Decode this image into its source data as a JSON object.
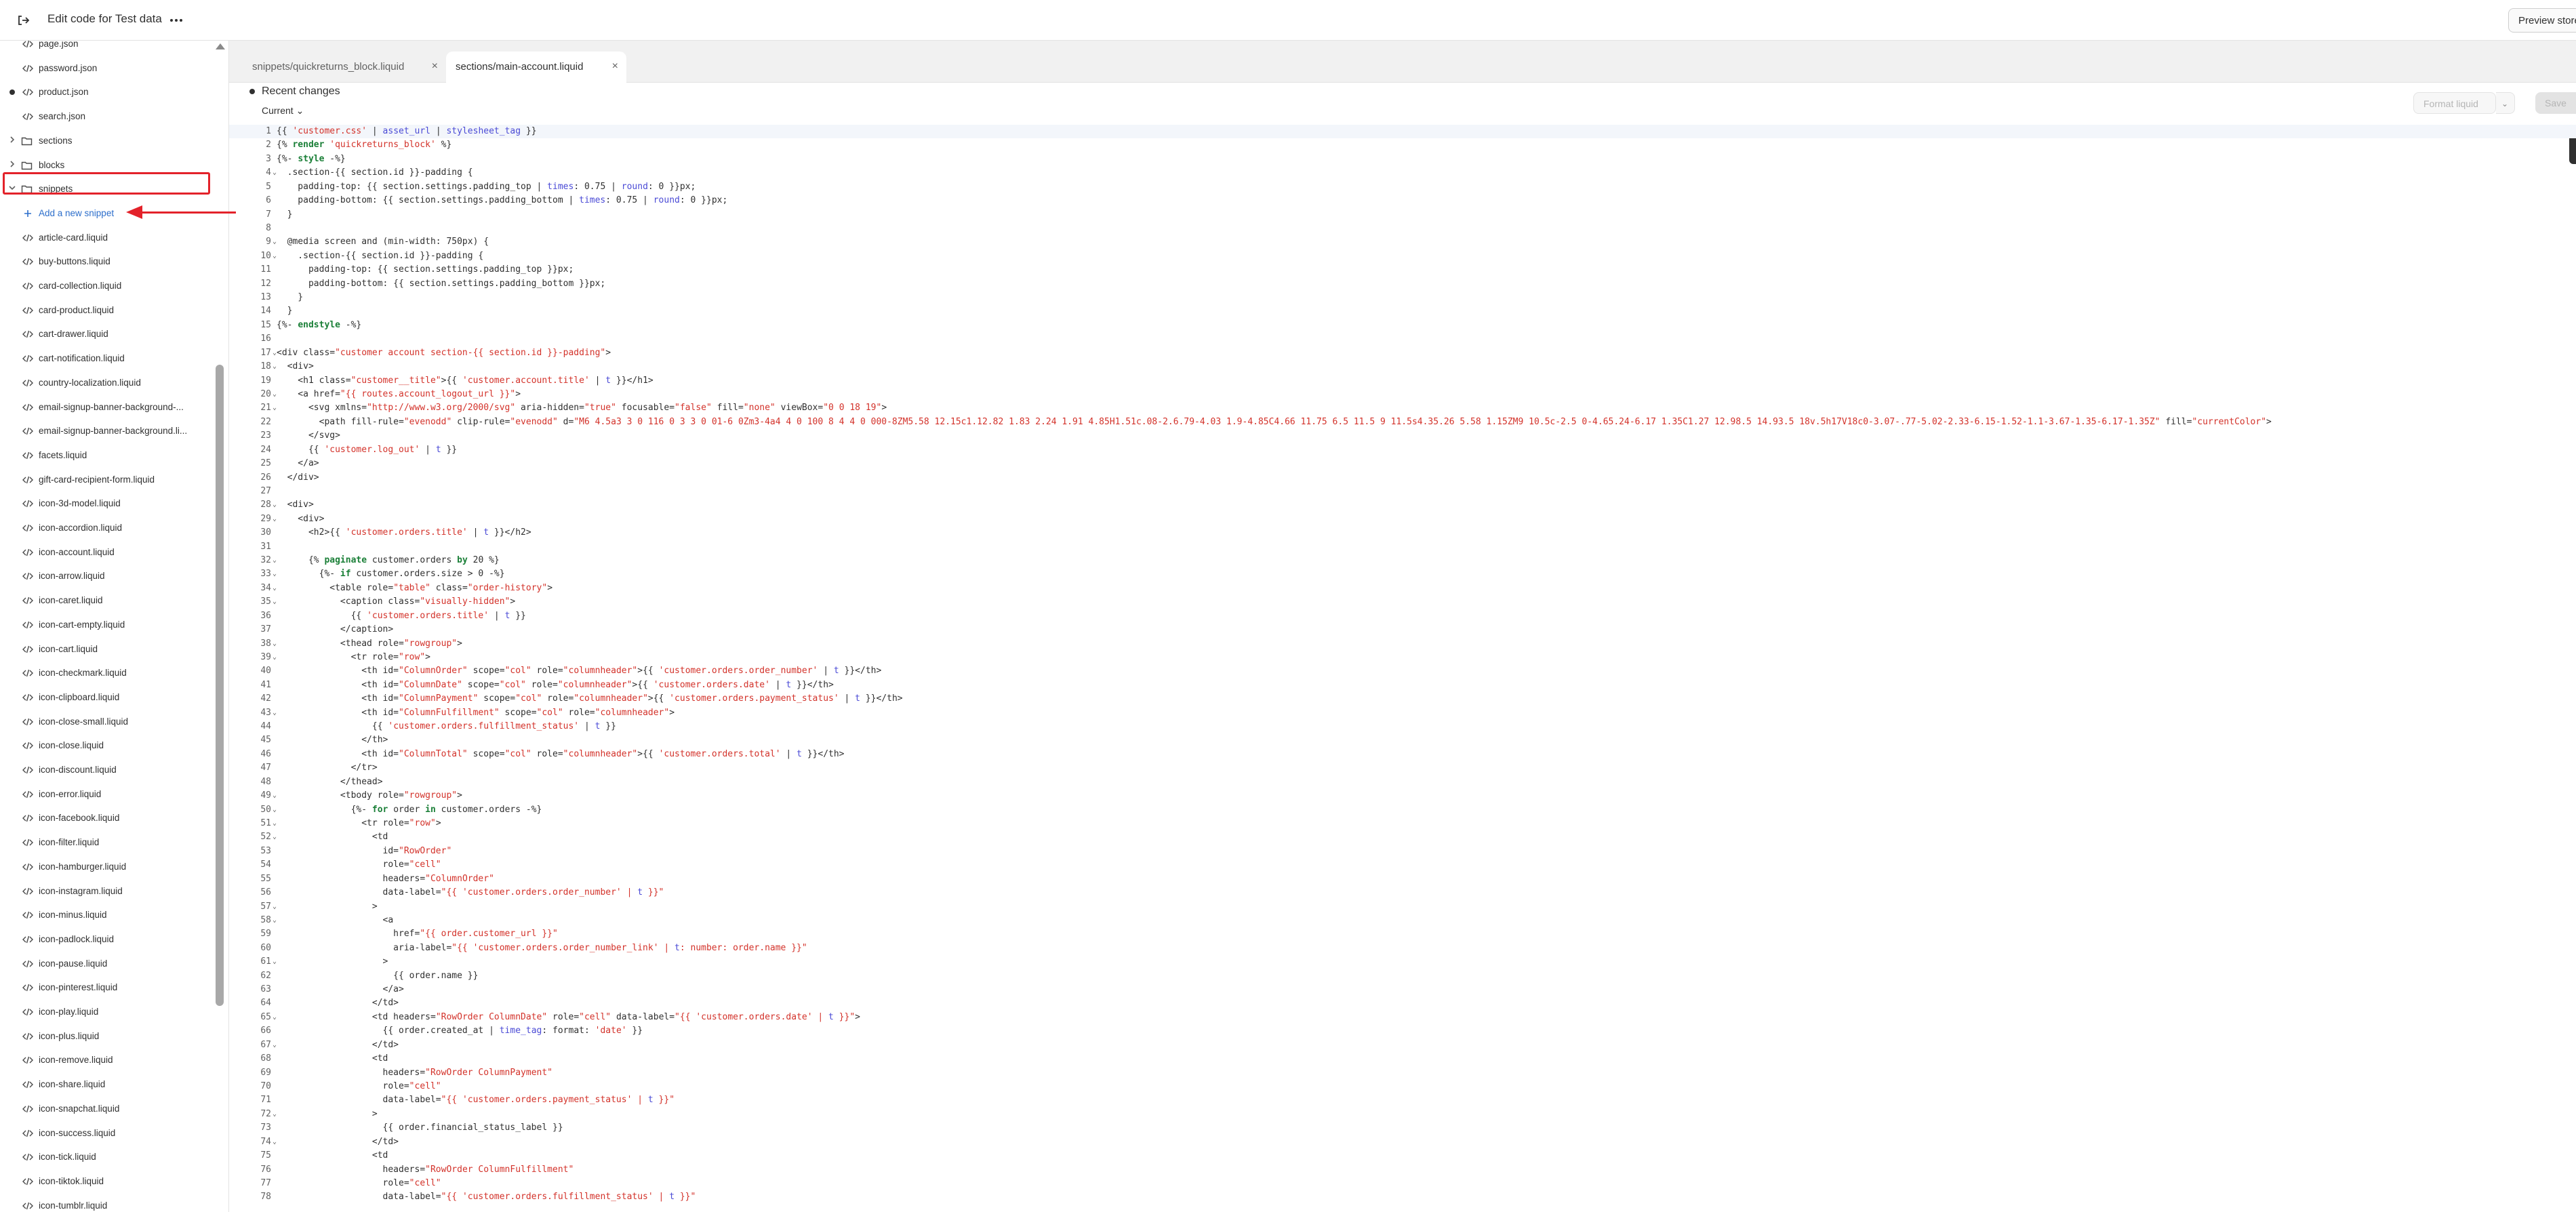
{
  "topbar": {
    "title": "Edit code for Test data",
    "preview_label": "Preview store",
    "exit_icon": "exit-icon",
    "more_icon": "more-horizontal-icon"
  },
  "sidebar": {
    "items": [
      {
        "label": "page.json",
        "kind": "file"
      },
      {
        "label": "password.json",
        "kind": "file"
      },
      {
        "label": "product.json",
        "kind": "file",
        "modified": true
      },
      {
        "label": "search.json",
        "kind": "file"
      },
      {
        "label": "sections",
        "kind": "folder"
      },
      {
        "label": "blocks",
        "kind": "folder"
      },
      {
        "label": "snippets",
        "kind": "folder-open"
      },
      {
        "label": "Add a new snippet",
        "kind": "add"
      },
      {
        "label": "article-card.liquid",
        "kind": "file"
      },
      {
        "label": "buy-buttons.liquid",
        "kind": "file"
      },
      {
        "label": "card-collection.liquid",
        "kind": "file"
      },
      {
        "label": "card-product.liquid",
        "kind": "file"
      },
      {
        "label": "cart-drawer.liquid",
        "kind": "file"
      },
      {
        "label": "cart-notification.liquid",
        "kind": "file"
      },
      {
        "label": "country-localization.liquid",
        "kind": "file"
      },
      {
        "label": "email-signup-banner-background-...",
        "kind": "file"
      },
      {
        "label": "email-signup-banner-background.li...",
        "kind": "file"
      },
      {
        "label": "facets.liquid",
        "kind": "file"
      },
      {
        "label": "gift-card-recipient-form.liquid",
        "kind": "file"
      },
      {
        "label": "icon-3d-model.liquid",
        "kind": "file"
      },
      {
        "label": "icon-accordion.liquid",
        "kind": "file"
      },
      {
        "label": "icon-account.liquid",
        "kind": "file"
      },
      {
        "label": "icon-arrow.liquid",
        "kind": "file"
      },
      {
        "label": "icon-caret.liquid",
        "kind": "file"
      },
      {
        "label": "icon-cart-empty.liquid",
        "kind": "file"
      },
      {
        "label": "icon-cart.liquid",
        "kind": "file"
      },
      {
        "label": "icon-checkmark.liquid",
        "kind": "file"
      },
      {
        "label": "icon-clipboard.liquid",
        "kind": "file"
      },
      {
        "label": "icon-close-small.liquid",
        "kind": "file"
      },
      {
        "label": "icon-close.liquid",
        "kind": "file"
      },
      {
        "label": "icon-discount.liquid",
        "kind": "file"
      },
      {
        "label": "icon-error.liquid",
        "kind": "file"
      },
      {
        "label": "icon-facebook.liquid",
        "kind": "file"
      },
      {
        "label": "icon-filter.liquid",
        "kind": "file"
      },
      {
        "label": "icon-hamburger.liquid",
        "kind": "file"
      },
      {
        "label": "icon-instagram.liquid",
        "kind": "file"
      },
      {
        "label": "icon-minus.liquid",
        "kind": "file"
      },
      {
        "label": "icon-padlock.liquid",
        "kind": "file"
      },
      {
        "label": "icon-pause.liquid",
        "kind": "file"
      },
      {
        "label": "icon-pinterest.liquid",
        "kind": "file"
      },
      {
        "label": "icon-play.liquid",
        "kind": "file"
      },
      {
        "label": "icon-plus.liquid",
        "kind": "file"
      },
      {
        "label": "icon-remove.liquid",
        "kind": "file"
      },
      {
        "label": "icon-share.liquid",
        "kind": "file"
      },
      {
        "label": "icon-snapchat.liquid",
        "kind": "file"
      },
      {
        "label": "icon-success.liquid",
        "kind": "file"
      },
      {
        "label": "icon-tick.liquid",
        "kind": "file"
      },
      {
        "label": "icon-tiktok.liquid",
        "kind": "file"
      },
      {
        "label": "icon-tumblr.liquid",
        "kind": "file"
      }
    ]
  },
  "tabs": [
    {
      "label": "snippets/quickreturns_block.liquid",
      "active": false
    },
    {
      "label": "sections/main-account.liquid",
      "active": true
    }
  ],
  "editor": {
    "recent_changes": "Recent changes",
    "version_select": "Current",
    "format_button": "Format liquid",
    "save_button": "Save"
  },
  "code_lines": [
    "{{ 'customer.css' | asset_url | stylesheet_tag }}",
    "{% render 'quickreturns_block' %}",
    "{%- style -%}",
    "  .section-{{ section.id }}-padding {",
    "    padding-top: {{ section.settings.padding_top | times: 0.75 | round: 0 }}px;",
    "    padding-bottom: {{ section.settings.padding_bottom | times: 0.75 | round: 0 }}px;",
    "  }",
    "",
    "  @media screen and (min-width: 750px) {",
    "    .section-{{ section.id }}-padding {",
    "      padding-top: {{ section.settings.padding_top }}px;",
    "      padding-bottom: {{ section.settings.padding_bottom }}px;",
    "    }",
    "  }",
    "{%- endstyle -%}",
    "",
    "<div class=\"customer account section-{{ section.id }}-padding\">",
    "  <div>",
    "    <h1 class=\"customer__title\">{{ 'customer.account.title' | t }}</h1>",
    "    <a href=\"{{ routes.account_logout_url }}\">",
    "      <svg xmlns=\"http://www.w3.org/2000/svg\" aria-hidden=\"true\" focusable=\"false\" fill=\"none\" viewBox=\"0 0 18 19\">",
    "        <path fill-rule=\"evenodd\" clip-rule=\"evenodd\" d=\"M6 4.5a3 3 0 116 0 3 3 0 01-6 0Zm3-4a4 4 0 100 8 4 4 0 000-8ZM5.58 12.15c1.12.82 1.83 2.24 1.91 4.85H1.51c.08-2.6.79-4.03 1.9-4.85C4.66 11.75 6.5 11.5 9 11.5s4.35.26 5.58 1.15ZM9 10.5c-2.5 0-4.65.24-6.17 1.35C1.27 12.98.5 14.93.5 18v.5h17V18c0-3.07-.77-5.02-2.33-6.15-1.52-1.1-3.67-1.35-6.17-1.35Z\" fill=\"currentColor\">",
    "      </svg>",
    "      {{ 'customer.log_out' | t }}",
    "    </a>",
    "  </div>",
    "",
    "  <div>",
    "    <div>",
    "      <h2>{{ 'customer.orders.title' | t }}</h2>",
    "",
    "      {% paginate customer.orders by 20 %}",
    "        {%- if customer.orders.size > 0 -%}",
    "          <table role=\"table\" class=\"order-history\">",
    "            <caption class=\"visually-hidden\">",
    "              {{ 'customer.orders.title' | t }}",
    "            </caption>",
    "            <thead role=\"rowgroup\">",
    "              <tr role=\"row\">",
    "                <th id=\"ColumnOrder\" scope=\"col\" role=\"columnheader\">{{ 'customer.orders.order_number' | t }}</th>",
    "                <th id=\"ColumnDate\" scope=\"col\" role=\"columnheader\">{{ 'customer.orders.date' | t }}</th>",
    "                <th id=\"ColumnPayment\" scope=\"col\" role=\"columnheader\">{{ 'customer.orders.payment_status' | t }}</th>",
    "                <th id=\"ColumnFulfillment\" scope=\"col\" role=\"columnheader\">",
    "                  {{ 'customer.orders.fulfillment_status' | t }}",
    "                </th>",
    "                <th id=\"ColumnTotal\" scope=\"col\" role=\"columnheader\">{{ 'customer.orders.total' | t }}</th>",
    "              </tr>",
    "            </thead>",
    "            <tbody role=\"rowgroup\">",
    "              {%- for order in customer.orders -%}",
    "                <tr role=\"row\">",
    "                  <td",
    "                    id=\"RowOrder\"",
    "                    role=\"cell\"",
    "                    headers=\"ColumnOrder\"",
    "                    data-label=\"{{ 'customer.orders.order_number' | t }}\"",
    "                  >",
    "                    <a",
    "                      href=\"{{ order.customer_url }}\"",
    "                      aria-label=\"{{ 'customer.orders.order_number_link' | t: number: order.name }}\"",
    "                    >",
    "                      {{ order.name }}",
    "                    </a>",
    "                  </td>",
    "                  <td headers=\"RowOrder ColumnDate\" role=\"cell\" data-label=\"{{ 'customer.orders.date' | t }}\">",
    "                    {{ order.created_at | time_tag: format: 'date' }}",
    "                  </td>",
    "                  <td",
    "                    headers=\"RowOrder ColumnPayment\"",
    "                    role=\"cell\"",
    "                    data-label=\"{{ 'customer.orders.payment_status' | t }}\"",
    "                  >",
    "                    {{ order.financial_status_label }}",
    "                  </td>",
    "                  <td",
    "                    headers=\"RowOrder ColumnFulfillment\"",
    "                    role=\"cell\"",
    "                    data-label=\"{{ 'customer.orders.fulfillment_status' | t }}\""
  ],
  "fold_lines": [
    4,
    9,
    10,
    17,
    18,
    20,
    21,
    28,
    29,
    32,
    33,
    34,
    35,
    38,
    39,
    43,
    49,
    50,
    51,
    52,
    57,
    58,
    61,
    65,
    67,
    72,
    74
  ]
}
